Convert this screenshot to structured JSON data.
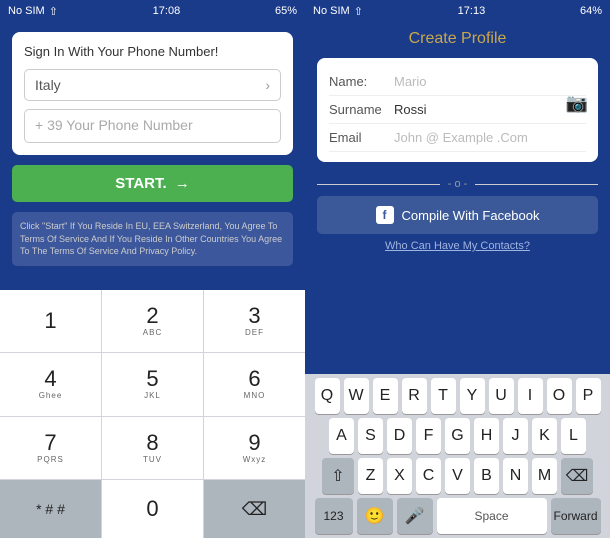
{
  "left_phone": {
    "status_bar": {
      "carrier": "No SIM",
      "time": "17:08",
      "battery": "65%"
    },
    "card": {
      "title": "Sign In With Your Phone Number!",
      "country": "Italy",
      "phone_placeholder": "+ 39 Your Phone Number",
      "start_button": "START.",
      "arrow": "→"
    },
    "terms": "Click \"Start\" If You Reside In EU, EEA Switzerland, You Agree To Terms Of Service And If You Reside In Other Countries You Agree To The Terms Of Service And Privacy Policy.",
    "keyboard": {
      "rows": [
        [
          {
            "main": "1",
            "sub": ""
          },
          {
            "main": "2",
            "sub": "ABC"
          },
          {
            "main": "3",
            "sub": "DEF"
          }
        ],
        [
          {
            "main": "4",
            "sub": "Ghee"
          },
          {
            "main": "5",
            "sub": "JKL"
          },
          {
            "main": "6",
            "sub": "MNO"
          }
        ],
        [
          {
            "main": "7",
            "sub": "PQRS"
          },
          {
            "main": "8",
            "sub": "TUV"
          },
          {
            "main": "9",
            "sub": "Wxyz"
          }
        ],
        [
          {
            "main": "* # #",
            "sub": ""
          },
          {
            "main": "0",
            "sub": ""
          },
          {
            "main": "⌫",
            "sub": ""
          }
        ]
      ]
    }
  },
  "right_phone": {
    "status_bar": {
      "carrier": "No SIM",
      "time": "17:13",
      "battery": "64%"
    },
    "title": "Create Profile",
    "fields": [
      {
        "label": "Name:",
        "value": "",
        "placeholder": "Mario"
      },
      {
        "label": "Surname",
        "value": "Rossi",
        "placeholder": ""
      },
      {
        "label": "Email",
        "value": "",
        "placeholder": "John @ Example .Com"
      }
    ],
    "divider_text": "- o -",
    "fb_button": "Compile With Facebook",
    "contacts_text": "Who Can Have My Contacts?",
    "keyboard": {
      "row1": [
        "Q",
        "W",
        "E",
        "R",
        "T",
        "Y",
        "U",
        "I",
        "O",
        "P"
      ],
      "row2": [
        "A",
        "S",
        "D",
        "F",
        "G",
        "H",
        "J",
        "K",
        "L"
      ],
      "row3": [
        "Z",
        "X",
        "C",
        "V",
        "B",
        "N",
        "M"
      ],
      "bottom": {
        "num": "123",
        "space": "Space",
        "forward": "Forward"
      }
    }
  }
}
